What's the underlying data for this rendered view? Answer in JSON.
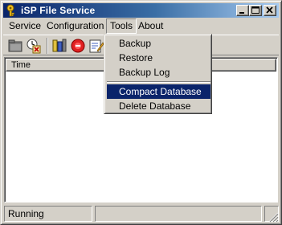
{
  "window": {
    "title": "iSP File Service"
  },
  "menubar": {
    "items": [
      "Service",
      "Configuration",
      "Tools",
      "About"
    ]
  },
  "tools_menu": {
    "items": [
      "Backup",
      "Restore",
      "Backup Log",
      "Compact Database",
      "Delete Database"
    ],
    "highlighted": "Compact Database"
  },
  "toolbar": {
    "icons": [
      "folder-icon",
      "settings-clock-icon",
      "service-config-icon",
      "stop-icon",
      "edit-icon"
    ]
  },
  "list": {
    "columns": [
      "Time"
    ]
  },
  "status": {
    "state": "Running"
  },
  "colors": {
    "title_active": "#0a246a",
    "highlight": "#0a246a",
    "face": "#d4d0c8"
  }
}
